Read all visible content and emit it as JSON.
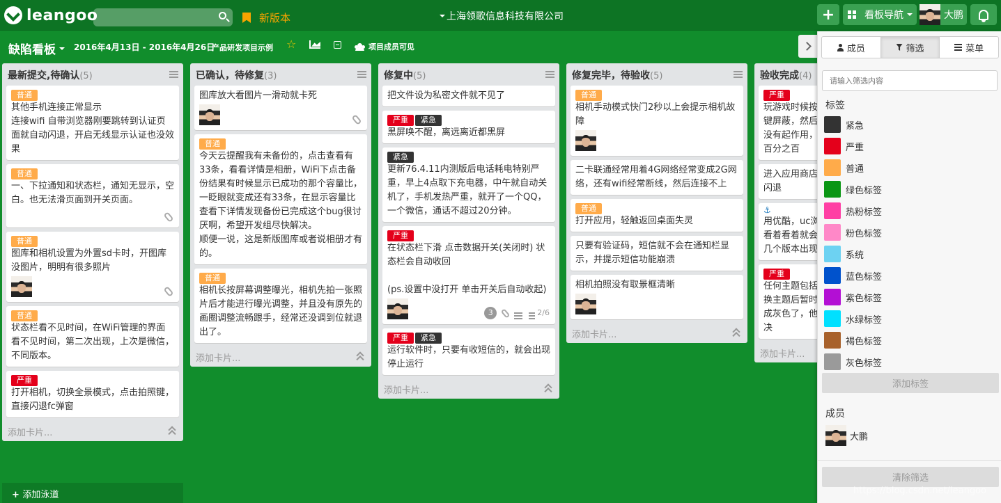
{
  "topbar": {
    "logo": "leangoo",
    "search_placeholder": "",
    "new_version": "新版本",
    "company": "上海领歌信息科技有限公司",
    "board_nav": "看板导航",
    "user_name": "大鹏"
  },
  "board": {
    "title": "缺陷看板",
    "date_range": "2016年4月13日 - 2016年4月26日",
    "project": "产品研发项目示例",
    "visibility": "项目成员可见"
  },
  "add_card_label": "添加卡片...",
  "add_lane_label": "添加泳道",
  "lanes": [
    {
      "title": "最新提交,待确认",
      "count": "(5)",
      "cards": [
        {
          "labels": [
            {
              "text": "普通",
              "kind": "normal"
            }
          ],
          "text": "其他手机连接正常显示\n连接wifi 自带浏览器刚要跳转到认证页面就自动闪退，开启无线显示认证也没效果",
          "avatar": false,
          "clip": false
        },
        {
          "labels": [
            {
              "text": "普通",
              "kind": "normal"
            }
          ],
          "text": "一、下拉通知和状态栏，通知无显示，空白。也无法滑页面到开关页面。",
          "avatar": false,
          "clip": true
        },
        {
          "labels": [
            {
              "text": "普通",
              "kind": "normal"
            }
          ],
          "text": "图库和相机设置为外置sd卡时，开图库没图片，明明有很多照片",
          "avatar": true,
          "clip": true
        },
        {
          "labels": [
            {
              "text": "普通",
              "kind": "normal"
            }
          ],
          "text": "状态栏看不见时间，在WiFi管理的界面看不见时间，第二次出现，上次是微信，不同版本。",
          "avatar": false,
          "clip": false
        },
        {
          "labels": [
            {
              "text": "严重",
              "kind": "severe"
            }
          ],
          "text": "打开相机，切换全景模式，点击拍照键，直接闪退fc弹窗",
          "avatar": false,
          "clip": false
        }
      ]
    },
    {
      "title": "已确认，待修复",
      "count": "(3)",
      "cards": [
        {
          "labels": [],
          "text": "图库放大看图片一滑动就卡死",
          "avatar": true,
          "clip": true
        },
        {
          "labels": [
            {
              "text": "普通",
              "kind": "normal"
            }
          ],
          "text": "今天云提醒我有未备份的，点击查看有33条，看看详情是相册，WiFi下点击备份结果有时候显示已成功的那个容量比，一眨眼就变成还有33条，在显示容量比查看下详情发现备份已完成这个bug很讨厌啊，希望开发组尽快解决。\n顺便一说，这是新版图库或者说相册才有的。",
          "avatar": false,
          "clip": false
        },
        {
          "labels": [
            {
              "text": "普通",
              "kind": "normal"
            }
          ],
          "text": "相机长按屏幕调整曝光，相机先拍一张照片后才能进行曝光调整，并且没有原先的画圈调整流畅跟手，经常还没调到位就退出了。",
          "avatar": false,
          "clip": false
        }
      ]
    },
    {
      "title": "修复中",
      "count": "(5)",
      "cards": [
        {
          "labels": [],
          "text": "把文件设为私密文件就不见了",
          "avatar": false,
          "clip": false
        },
        {
          "labels": [
            {
              "text": "严重",
              "kind": "severe"
            },
            {
              "text": "紧急",
              "kind": "urgent"
            }
          ],
          "text": "黑屏唤不醒，离远离近都黑屏",
          "avatar": false,
          "clip": false
        },
        {
          "labels": [
            {
              "text": "紧急",
              "kind": "urgent"
            }
          ],
          "text": "更新76.4.11内测版后电话耗电特别严重，早上4点取下充电器，中午就自动关机了，手机发热严重，就开了一个QQ，一个微信，通话不超过20分钟。",
          "avatar": false,
          "clip": false
        },
        {
          "labels": [
            {
              "text": "严重",
              "kind": "severe"
            }
          ],
          "text": "在状态栏下滑 点击数据开关(关闭时) 状态栏会自动收回\n\n(ps.设置中没打开 单击开关后自动收起)",
          "avatar": true,
          "clip": false,
          "badges": {
            "comments": "3",
            "checklist": "2/6"
          }
        },
        {
          "labels": [
            {
              "text": "严重",
              "kind": "severe"
            },
            {
              "text": "紧急",
              "kind": "urgent"
            }
          ],
          "text": "运行软件时，只要有收短信的，就会出现停止运行",
          "avatar": false,
          "clip": false
        }
      ]
    },
    {
      "title": "修复完毕，待验收",
      "count": "(5)",
      "cards": [
        {
          "labels": [
            {
              "text": "普通",
              "kind": "normal"
            }
          ],
          "text": "相机手动模式快门2秒以上会提示相机故障",
          "avatar": true,
          "clip": false
        },
        {
          "labels": [],
          "text": "二卡联通经常用着4G网络经常变成2G网络，还有wifi经常断线，然后连接不上",
          "avatar": false,
          "clip": false
        },
        {
          "labels": [
            {
              "text": "普通",
              "kind": "normal"
            }
          ],
          "text": "打开应用，轻触返回桌面失灵",
          "avatar": false,
          "clip": false
        },
        {
          "labels": [],
          "text": "只要有验证码，短信就不会在通知栏显示，并提示短信功能崩溃",
          "avatar": false,
          "clip": false
        },
        {
          "labels": [],
          "text": "相机拍照没有取景框清晰",
          "avatar": true,
          "clip": false
        }
      ]
    },
    {
      "title": "验收完成",
      "count": "(4)",
      "cards": [
        {
          "labels": [
            {
              "text": "严重",
              "kind": "severe"
            }
          ],
          "text": "玩游戏时候按\n键屏蔽，然后\n没有起作用，\n百分之百",
          "avatar": false,
          "clip": false
        },
        {
          "labels": [],
          "text": "进入应用商店\n闪退",
          "avatar": false,
          "clip": false
        },
        {
          "labels": [],
          "anchor": "⚓",
          "text": "用优酷，uc浏\n看着看着就会\n几个版本出现",
          "avatar": false,
          "clip": false
        },
        {
          "labels": [
            {
              "text": "严重",
              "kind": "severe"
            }
          ],
          "text": "任何主题包括\n换主题后暂时\n成灰色了，他\n决",
          "avatar": false,
          "clip": false
        }
      ]
    }
  ],
  "panel": {
    "tabs": [
      "成员",
      "筛选",
      "菜单"
    ],
    "active_tab": "筛选",
    "filter_placeholder": "请输入筛选内容",
    "labels_heading": "标签",
    "tags": [
      {
        "name": "紧急",
        "color": "#333333"
      },
      {
        "name": "严重",
        "color": "#e4001b"
      },
      {
        "name": "普通",
        "color": "#ffab4a"
      },
      {
        "name": "绿色标签",
        "color": "#0a9614"
      },
      {
        "name": "热粉标签",
        "color": "#ff3fa4"
      },
      {
        "name": "粉色标签",
        "color": "#ff88c8"
      },
      {
        "name": "系统",
        "color": "#6dd2f2"
      },
      {
        "name": "蓝色标签",
        "color": "#0052cc"
      },
      {
        "name": "紫色标签",
        "color": "#b30fd4"
      },
      {
        "name": "水绿标签",
        "color": "#00e0ff"
      },
      {
        "name": "褐色标签",
        "color": "#a8612b"
      },
      {
        "name": "灰色标签",
        "color": "#9a9a9a"
      }
    ],
    "add_tag": "添加标签",
    "members_heading": "成员",
    "member_name": "大鹏",
    "clear_filter": "清除筛选"
  },
  "watermark": "https://blog.csdn.net/leangoo"
}
